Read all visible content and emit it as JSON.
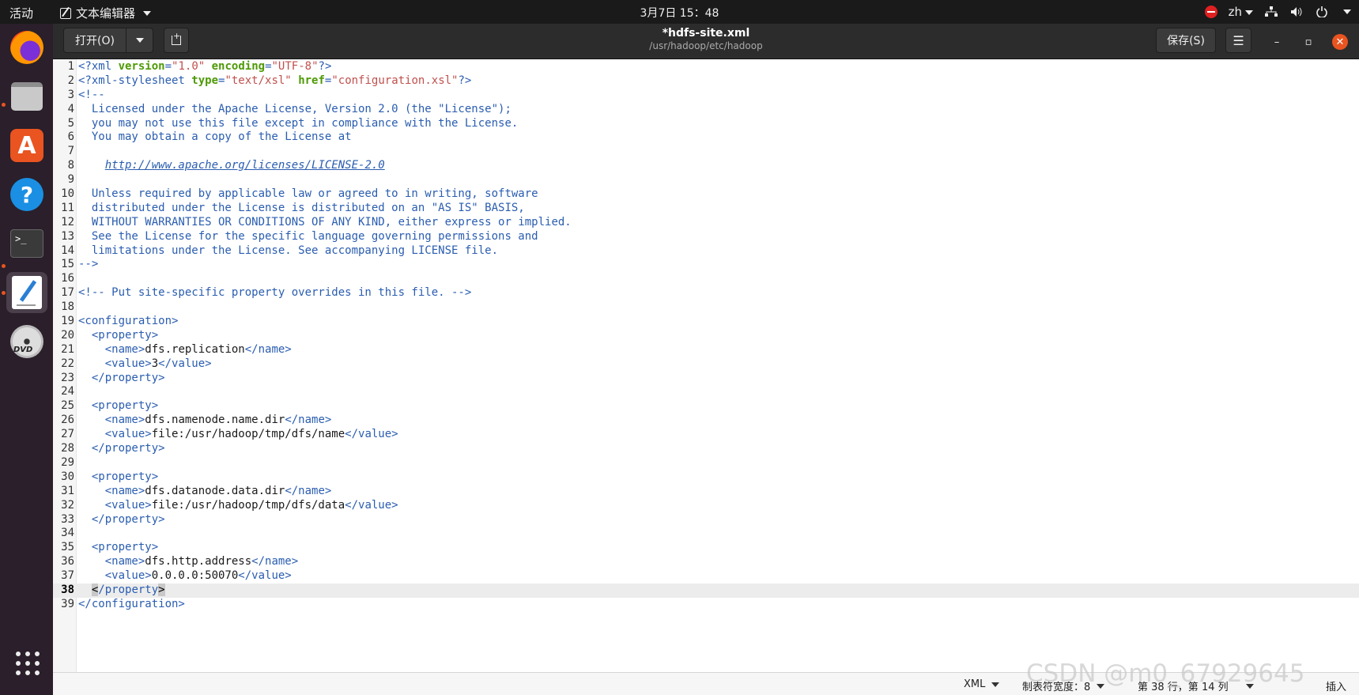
{
  "topbar": {
    "activities": "活动",
    "app_menu": "文本编辑器",
    "clock": "3月7日  15：48",
    "input_method": "zh"
  },
  "headerbar": {
    "open_label": "打开(O)",
    "title": "*hdfs-site.xml",
    "subtitle": "/usr/hadoop/etc/hadoop",
    "save_label": "保存(S)"
  },
  "dock": {
    "items": [
      "firefox-icon",
      "files-icon",
      "software-icon",
      "help-icon",
      "terminal-icon",
      "text-editor-icon",
      "dvd-icon"
    ]
  },
  "editor": {
    "current_line": 38,
    "lines": [
      {
        "n": "1",
        "tokens": [
          [
            "tag",
            "<?xml "
          ],
          [
            "attr",
            "version"
          ],
          [
            "tag",
            "="
          ],
          [
            "str",
            "\"1.0\""
          ],
          [
            "tag",
            " "
          ],
          [
            "attr",
            "encoding"
          ],
          [
            "tag",
            "="
          ],
          [
            "str",
            "\"UTF-8\""
          ],
          [
            "tag",
            "?>"
          ]
        ]
      },
      {
        "n": "2",
        "tokens": [
          [
            "tag",
            "<?xml-stylesheet "
          ],
          [
            "attr",
            "type"
          ],
          [
            "tag",
            "="
          ],
          [
            "str",
            "\"text/xsl\""
          ],
          [
            "tag",
            " "
          ],
          [
            "attr",
            "href"
          ],
          [
            "tag",
            "="
          ],
          [
            "str",
            "\"configuration.xsl\""
          ],
          [
            "tag",
            "?>"
          ]
        ]
      },
      {
        "n": "3",
        "tokens": [
          [
            "cmt",
            "<!--"
          ]
        ]
      },
      {
        "n": "4",
        "tokens": [
          [
            "cmt",
            "  Licensed under the Apache License, Version 2.0 (the \"License\");"
          ]
        ]
      },
      {
        "n": "5",
        "tokens": [
          [
            "cmt",
            "  you may not use this file except in compliance with the License."
          ]
        ]
      },
      {
        "n": "6",
        "tokens": [
          [
            "cmt",
            "  You may obtain a copy of the License at"
          ]
        ]
      },
      {
        "n": "7",
        "tokens": []
      },
      {
        "n": "8",
        "tokens": [
          [
            "cmt",
            "    "
          ],
          [
            "url",
            "http://www.apache.org/licenses/LICENSE-2.0"
          ]
        ]
      },
      {
        "n": "9",
        "tokens": []
      },
      {
        "n": "10",
        "tokens": [
          [
            "cmt",
            "  Unless required by applicable law or agreed to in writing, software"
          ]
        ]
      },
      {
        "n": "11",
        "tokens": [
          [
            "cmt",
            "  distributed under the License is distributed on an \"AS IS\" BASIS,"
          ]
        ]
      },
      {
        "n": "12",
        "tokens": [
          [
            "cmt",
            "  WITHOUT WARRANTIES OR CONDITIONS OF ANY KIND, either express or implied."
          ]
        ]
      },
      {
        "n": "13",
        "tokens": [
          [
            "cmt",
            "  See the License for the specific language governing permissions and"
          ]
        ]
      },
      {
        "n": "14",
        "tokens": [
          [
            "cmt",
            "  limitations under the License. See accompanying LICENSE file."
          ]
        ]
      },
      {
        "n": "15",
        "tokens": [
          [
            "cmt",
            "-->"
          ]
        ]
      },
      {
        "n": "16",
        "tokens": []
      },
      {
        "n": "17",
        "tokens": [
          [
            "cmt",
            "<!-- Put site-specific property overrides in this file. -->"
          ]
        ]
      },
      {
        "n": "18",
        "tokens": []
      },
      {
        "n": "19",
        "tokens": [
          [
            "tag",
            "<configuration>"
          ]
        ]
      },
      {
        "n": "20",
        "tokens": [
          [
            "tag",
            "  <property>"
          ]
        ]
      },
      {
        "n": "21",
        "tokens": [
          [
            "tag",
            "    <name>"
          ],
          [
            "txt",
            "dfs.replication"
          ],
          [
            "tag",
            "</name>"
          ]
        ]
      },
      {
        "n": "22",
        "tokens": [
          [
            "tag",
            "    <value>"
          ],
          [
            "txt",
            "3"
          ],
          [
            "tag",
            "</value>"
          ]
        ]
      },
      {
        "n": "23",
        "tokens": [
          [
            "tag",
            "  </property>"
          ]
        ]
      },
      {
        "n": "24",
        "tokens": []
      },
      {
        "n": "25",
        "tokens": [
          [
            "tag",
            "  <property>"
          ]
        ]
      },
      {
        "n": "26",
        "tokens": [
          [
            "tag",
            "    <name>"
          ],
          [
            "txt",
            "dfs.namenode.name.dir"
          ],
          [
            "tag",
            "</name>"
          ]
        ]
      },
      {
        "n": "27",
        "tokens": [
          [
            "tag",
            "    <value>"
          ],
          [
            "txt",
            "file:/usr/hadoop/tmp/dfs/name"
          ],
          [
            "tag",
            "</value>"
          ]
        ]
      },
      {
        "n": "28",
        "tokens": [
          [
            "tag",
            "  </property>"
          ]
        ]
      },
      {
        "n": "29",
        "tokens": []
      },
      {
        "n": "30",
        "tokens": [
          [
            "tag",
            "  <property>"
          ]
        ]
      },
      {
        "n": "31",
        "tokens": [
          [
            "tag",
            "    <name>"
          ],
          [
            "txt",
            "dfs.datanode.data.dir"
          ],
          [
            "tag",
            "</name>"
          ]
        ]
      },
      {
        "n": "32",
        "tokens": [
          [
            "tag",
            "    <value>"
          ],
          [
            "txt",
            "file:/usr/hadoop/tmp/dfs/data"
          ],
          [
            "tag",
            "</value>"
          ]
        ]
      },
      {
        "n": "33",
        "tokens": [
          [
            "tag",
            "  </property>"
          ]
        ]
      },
      {
        "n": "34",
        "tokens": []
      },
      {
        "n": "35",
        "tokens": [
          [
            "tag",
            "  <property>"
          ]
        ]
      },
      {
        "n": "36",
        "tokens": [
          [
            "tag",
            "    <name>"
          ],
          [
            "txt",
            "dfs.http.address"
          ],
          [
            "tag",
            "</name>"
          ]
        ]
      },
      {
        "n": "37",
        "tokens": [
          [
            "tag",
            "    <value>"
          ],
          [
            "txt",
            "0.0.0.0:50070"
          ],
          [
            "tag",
            "</value>"
          ]
        ]
      },
      {
        "n": "38",
        "tokens": [
          [
            "txt",
            "  "
          ],
          [
            "hl",
            "<"
          ],
          [
            "tag",
            "/property"
          ],
          [
            "hl",
            ">"
          ]
        ]
      },
      {
        "n": "39",
        "tokens": [
          [
            "tag",
            "</configuration>"
          ]
        ]
      }
    ]
  },
  "statusbar": {
    "language": "XML",
    "tab_width": "制表符宽度：8",
    "cursor_position": "第 38 行，第 14 列",
    "insert_mode": "插入"
  },
  "watermark": "CSDN @m0_67929645",
  "colors": {
    "tag": "#2a5db0",
    "attr": "#4e9a06",
    "string": "#c0504d",
    "accent": "#e95420"
  }
}
